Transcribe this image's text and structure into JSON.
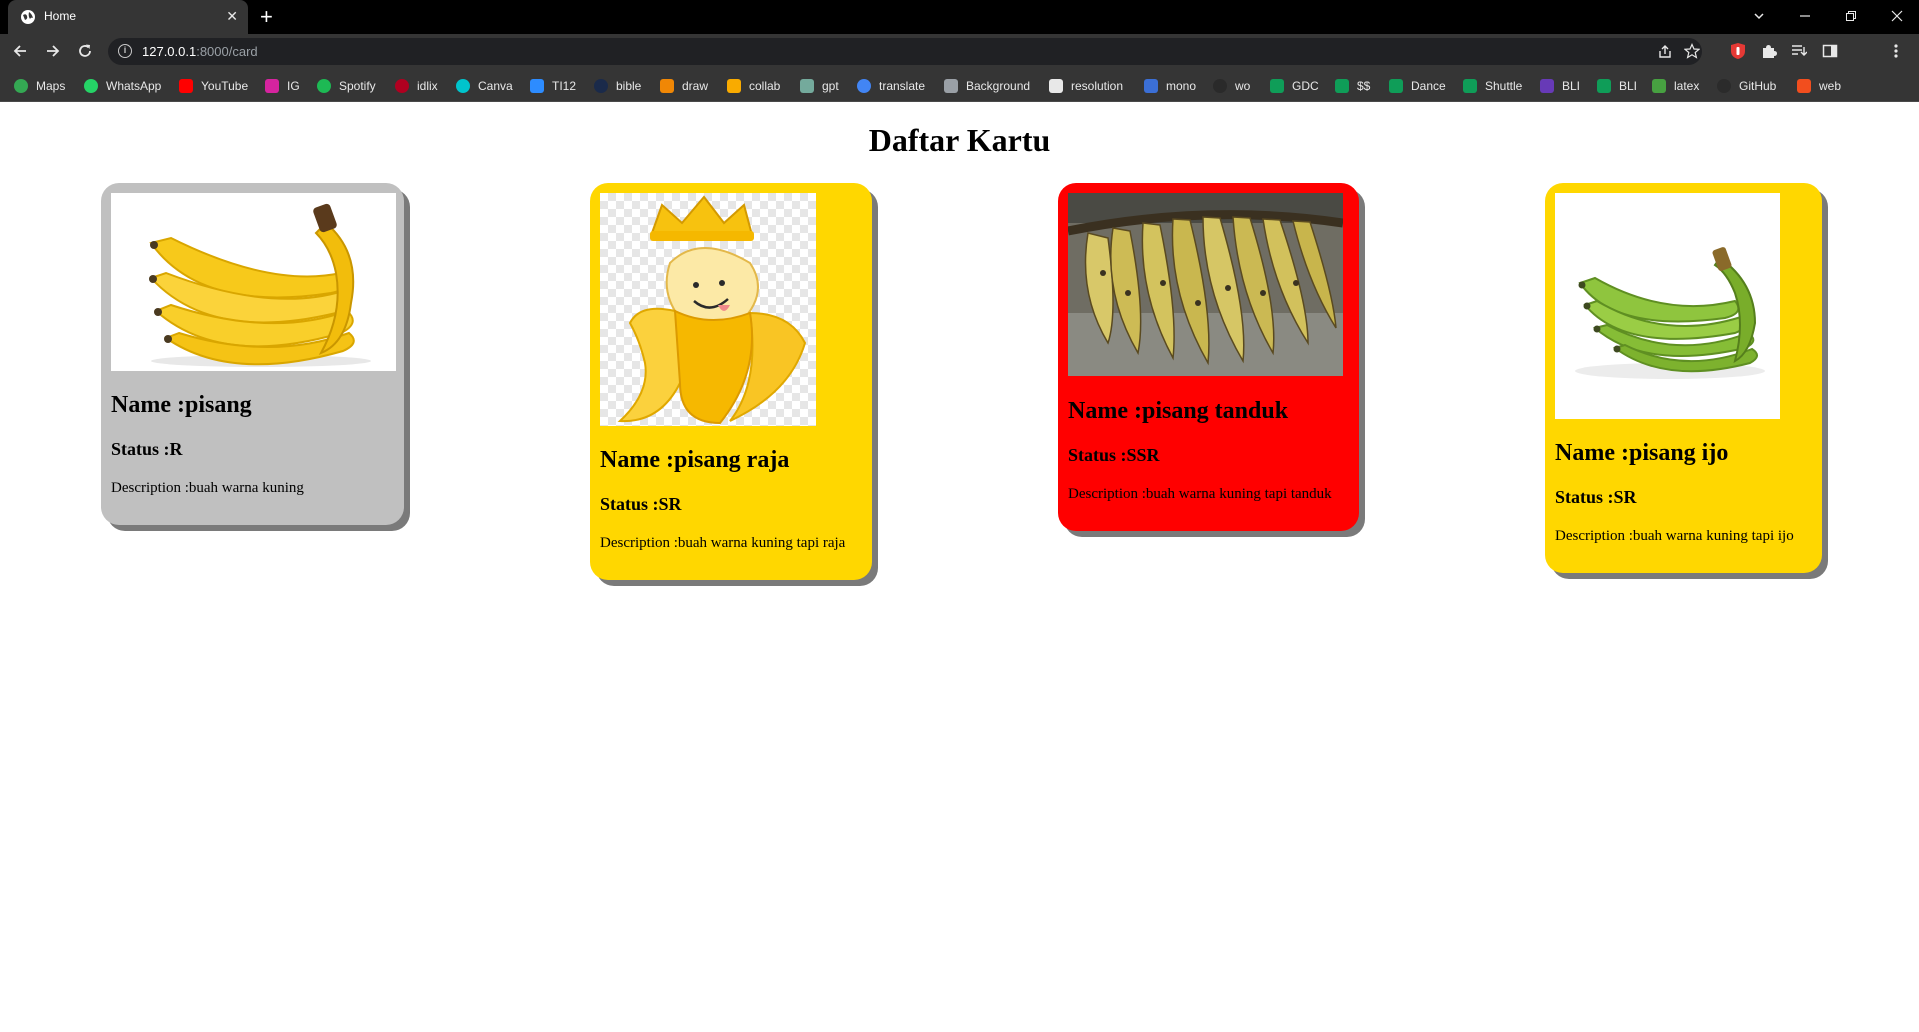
{
  "browser": {
    "tab_title": "Home",
    "tab_close_glyph": "✕",
    "new_tab_glyph": "+",
    "url_host": "127.0.0.1",
    "url_path": ":8000/card",
    "bookmarks": [
      {
        "label": "Maps",
        "icon": "maps-icon",
        "color": "#34a853"
      },
      {
        "label": "WhatsApp",
        "icon": "whatsapp-icon",
        "color": "#25d366"
      },
      {
        "label": "YouTube",
        "icon": "youtube-icon",
        "color": "#ff0000"
      },
      {
        "label": "IG",
        "icon": "instagram-icon",
        "color": "#d6249f"
      },
      {
        "label": "Spotify",
        "icon": "spotify-icon",
        "color": "#1db954"
      },
      {
        "label": "idlix",
        "icon": "idlix-icon",
        "color": "#b00020"
      },
      {
        "label": "Canva",
        "icon": "canva-icon",
        "color": "#00c4cc"
      },
      {
        "label": "TI12",
        "icon": "zoom-icon",
        "color": "#2d8cff"
      },
      {
        "label": "bible",
        "icon": "bible-icon",
        "color": "#1a2a4a"
      },
      {
        "label": "draw",
        "icon": "draw-icon",
        "color": "#f08705"
      },
      {
        "label": "collab",
        "icon": "colab-icon",
        "color": "#f9ab00"
      },
      {
        "label": "gpt",
        "icon": "chatgpt-icon",
        "color": "#74aa9c"
      },
      {
        "label": "translate",
        "icon": "google-icon",
        "color": "#4285f4"
      },
      {
        "label": "Background",
        "icon": "layers-icon",
        "color": "#9aa0a6"
      },
      {
        "label": "resolution",
        "icon": "c-icon",
        "color": "#e8e8e8"
      },
      {
        "label": "mono",
        "icon": "mono-icon",
        "color": "#3b6fd6"
      },
      {
        "label": "wo",
        "icon": "wo-icon",
        "color": "#2a2a2a"
      },
      {
        "label": "GDC",
        "icon": "sheets-icon",
        "color": "#0f9d58"
      },
      {
        "label": "$$",
        "icon": "sheets-icon",
        "color": "#0f9d58"
      },
      {
        "label": "Dance",
        "icon": "sheets-icon",
        "color": "#0f9d58"
      },
      {
        "label": "Shuttle",
        "icon": "sheets-icon",
        "color": "#0f9d58"
      },
      {
        "label": "BLI",
        "icon": "forms-icon",
        "color": "#673ab7"
      },
      {
        "label": "BLI",
        "icon": "sheets-icon",
        "color": "#0f9d58"
      },
      {
        "label": "latex",
        "icon": "overleaf-icon",
        "color": "#47a141"
      },
      {
        "label": "GitHub",
        "icon": "github-icon",
        "color": "#2b2b2b"
      },
      {
        "label": "web",
        "icon": "figma-icon",
        "color": "#f24e1e"
      }
    ]
  },
  "page": {
    "title": "Daftar Kartu",
    "cards": [
      {
        "name": "Name :pisang",
        "status": "Status :R",
        "description": "Description :buah warna kuning",
        "background": "#c0c0c0",
        "image": "banana-bunch-image"
      },
      {
        "name": "Name :pisang raja",
        "status": "Status :SR",
        "description": "Description :buah warna kuning tapi raja",
        "background": "#ffd700",
        "image": "crowned-banana-cartoon-image"
      },
      {
        "name": "Name :pisang tanduk",
        "status": "Status :SSR",
        "description": "Description :buah warna kuning tapi tanduk",
        "background": "#ff0000",
        "image": "plantain-bunch-image"
      },
      {
        "name": "Name :pisang ijo",
        "status": "Status :SR",
        "description": "Description :buah warna kuning tapi ijo",
        "background": "#ffd700",
        "image": "green-banana-image"
      }
    ]
  }
}
